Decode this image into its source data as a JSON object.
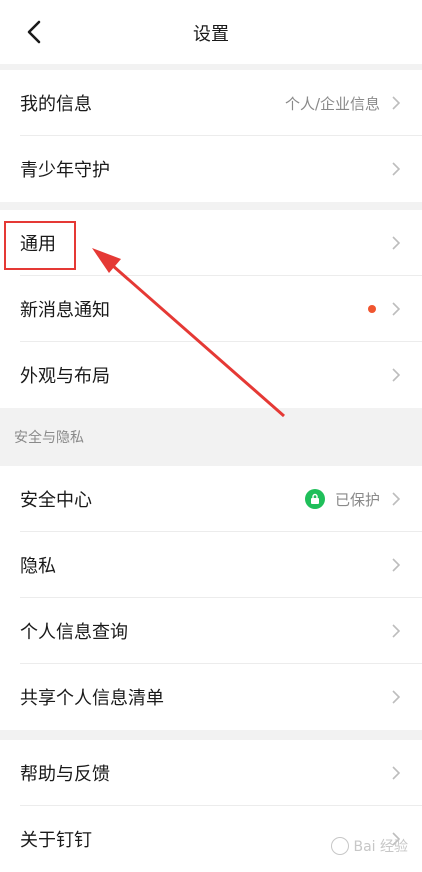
{
  "header": {
    "title": "设置",
    "back_icon": "back-chevron-icon"
  },
  "groups": [
    {
      "items": [
        {
          "label": "我的信息",
          "value": "个人/企业信息"
        },
        {
          "label": "青少年守护",
          "value": ""
        }
      ]
    },
    {
      "items": [
        {
          "label": "通用",
          "value": "",
          "highlighted": true
        },
        {
          "label": "新消息通知",
          "value": "",
          "dot": true
        },
        {
          "label": "外观与布局",
          "value": ""
        }
      ]
    },
    {
      "section_title": "安全与隐私",
      "items": [
        {
          "label": "安全中心",
          "value": "已保护",
          "lock": true
        },
        {
          "label": "隐私",
          "value": ""
        },
        {
          "label": "个人信息查询",
          "value": ""
        },
        {
          "label": "共享个人信息清单",
          "value": ""
        }
      ]
    },
    {
      "items": [
        {
          "label": "帮助与反馈",
          "value": ""
        },
        {
          "label": "关于钉钉",
          "value": ""
        }
      ]
    }
  ],
  "watermark": "Bai 经验",
  "colors": {
    "accent_red": "#e53935",
    "dot_orange": "#f0552f",
    "lock_green": "#1fbf5a"
  }
}
